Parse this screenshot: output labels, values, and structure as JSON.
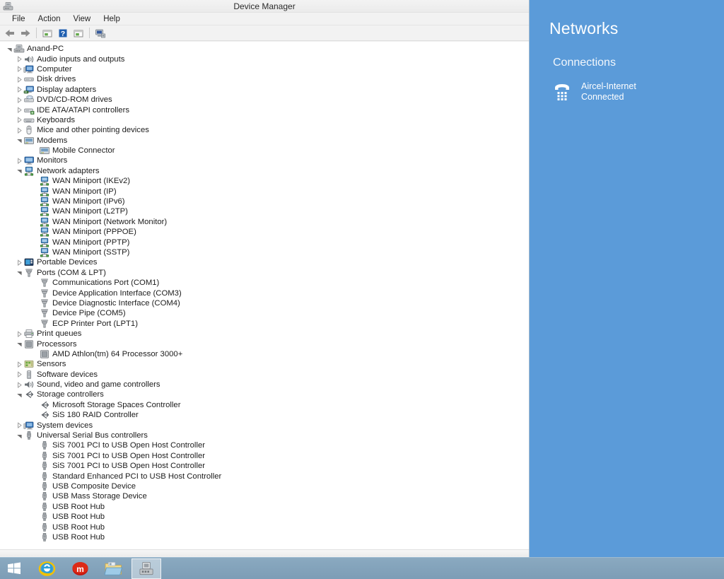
{
  "window": {
    "title": "Device Manager",
    "title_icon": "device-manager-icon",
    "menus": [
      "File",
      "Action",
      "View",
      "Help"
    ],
    "toolbar_buttons": [
      {
        "name": "back-button",
        "icon": "back-arrow-icon"
      },
      {
        "name": "forward-button",
        "icon": "forward-arrow-icon"
      },
      {
        "name": "show-hidden-devices-button",
        "icon": "window-list-icon"
      },
      {
        "name": "help-button",
        "icon": "question-mark-icon"
      },
      {
        "name": "properties-button",
        "icon": "window-list-icon"
      },
      {
        "name": "scan-hardware-changes-button",
        "icon": "scan-monitor-icon"
      }
    ]
  },
  "tree": [
    {
      "label": "Anand-PC",
      "level": 0,
      "state": "expanded",
      "icon": "computer-icon"
    },
    {
      "label": "Audio inputs and outputs",
      "level": 1,
      "state": "collapsed",
      "icon": "speaker-icon"
    },
    {
      "label": "Computer",
      "level": 1,
      "state": "collapsed",
      "icon": "computer-monitor-icon"
    },
    {
      "label": "Disk drives",
      "level": 1,
      "state": "collapsed",
      "icon": "disk-drive-icon"
    },
    {
      "label": "Display adapters",
      "level": 1,
      "state": "collapsed",
      "icon": "display-adapter-icon"
    },
    {
      "label": "DVD/CD-ROM drives",
      "level": 1,
      "state": "collapsed",
      "icon": "dvd-drive-icon"
    },
    {
      "label": "IDE ATA/ATAPI controllers",
      "level": 1,
      "state": "collapsed",
      "icon": "ide-controller-icon"
    },
    {
      "label": "Keyboards",
      "level": 1,
      "state": "collapsed",
      "icon": "keyboard-icon"
    },
    {
      "label": "Mice and other pointing devices",
      "level": 1,
      "state": "collapsed",
      "icon": "mouse-icon"
    },
    {
      "label": "Modems",
      "level": 1,
      "state": "expanded",
      "icon": "modem-icon"
    },
    {
      "label": "Mobile Connector",
      "level": 2,
      "state": "leaf",
      "icon": "modem-icon"
    },
    {
      "label": "Monitors",
      "level": 1,
      "state": "collapsed",
      "icon": "monitor-icon"
    },
    {
      "label": "Network adapters",
      "level": 1,
      "state": "expanded",
      "icon": "network-adapter-icon"
    },
    {
      "label": "WAN Miniport (IKEv2)",
      "level": 2,
      "state": "leaf",
      "icon": "network-adapter-icon"
    },
    {
      "label": "WAN Miniport (IP)",
      "level": 2,
      "state": "leaf",
      "icon": "network-adapter-icon"
    },
    {
      "label": "WAN Miniport (IPv6)",
      "level": 2,
      "state": "leaf",
      "icon": "network-adapter-icon"
    },
    {
      "label": "WAN Miniport (L2TP)",
      "level": 2,
      "state": "leaf",
      "icon": "network-adapter-icon"
    },
    {
      "label": "WAN Miniport (Network Monitor)",
      "level": 2,
      "state": "leaf",
      "icon": "network-adapter-icon"
    },
    {
      "label": "WAN Miniport (PPPOE)",
      "level": 2,
      "state": "leaf",
      "icon": "network-adapter-icon"
    },
    {
      "label": "WAN Miniport (PPTP)",
      "level": 2,
      "state": "leaf",
      "icon": "network-adapter-icon"
    },
    {
      "label": "WAN Miniport (SSTP)",
      "level": 2,
      "state": "leaf",
      "icon": "network-adapter-icon"
    },
    {
      "label": "Portable Devices",
      "level": 1,
      "state": "collapsed",
      "icon": "portable-device-icon"
    },
    {
      "label": "Ports (COM & LPT)",
      "level": 1,
      "state": "expanded",
      "icon": "port-icon"
    },
    {
      "label": "Communications Port (COM1)",
      "level": 2,
      "state": "leaf",
      "icon": "port-icon"
    },
    {
      "label": "Device Application Interface (COM3)",
      "level": 2,
      "state": "leaf",
      "icon": "port-icon"
    },
    {
      "label": "Device Diagnostic Interface (COM4)",
      "level": 2,
      "state": "leaf",
      "icon": "port-icon"
    },
    {
      "label": "Device Pipe (COM5)",
      "level": 2,
      "state": "leaf",
      "icon": "port-icon"
    },
    {
      "label": "ECP Printer Port (LPT1)",
      "level": 2,
      "state": "leaf",
      "icon": "port-icon"
    },
    {
      "label": "Print queues",
      "level": 1,
      "state": "collapsed",
      "icon": "printer-icon"
    },
    {
      "label": "Processors",
      "level": 1,
      "state": "expanded",
      "icon": "processor-icon"
    },
    {
      "label": "AMD Athlon(tm) 64 Processor 3000+",
      "level": 2,
      "state": "leaf",
      "icon": "processor-icon"
    },
    {
      "label": "Sensors",
      "level": 1,
      "state": "collapsed",
      "icon": "sensor-icon"
    },
    {
      "label": "Software devices",
      "level": 1,
      "state": "collapsed",
      "icon": "software-device-icon"
    },
    {
      "label": "Sound, video and game controllers",
      "level": 1,
      "state": "collapsed",
      "icon": "speaker-icon"
    },
    {
      "label": "Storage controllers",
      "level": 1,
      "state": "expanded",
      "icon": "storage-controller-icon"
    },
    {
      "label": "Microsoft Storage Spaces Controller",
      "level": 2,
      "state": "leaf",
      "icon": "storage-controller-icon"
    },
    {
      "label": "SiS 180 RAID Controller",
      "level": 2,
      "state": "leaf",
      "icon": "storage-controller-icon"
    },
    {
      "label": "System devices",
      "level": 1,
      "state": "collapsed",
      "icon": "computer-monitor-icon"
    },
    {
      "label": "Universal Serial Bus controllers",
      "level": 1,
      "state": "expanded",
      "icon": "usb-icon"
    },
    {
      "label": "SiS 7001 PCI to USB Open Host Controller",
      "level": 2,
      "state": "leaf",
      "icon": "usb-icon"
    },
    {
      "label": "SiS 7001 PCI to USB Open Host Controller",
      "level": 2,
      "state": "leaf",
      "icon": "usb-icon"
    },
    {
      "label": "SiS 7001 PCI to USB Open Host Controller",
      "level": 2,
      "state": "leaf",
      "icon": "usb-icon"
    },
    {
      "label": "Standard Enhanced PCI to USB Host Controller",
      "level": 2,
      "state": "leaf",
      "icon": "usb-icon"
    },
    {
      "label": "USB Composite Device",
      "level": 2,
      "state": "leaf",
      "icon": "usb-icon"
    },
    {
      "label": "USB Mass Storage Device",
      "level": 2,
      "state": "leaf",
      "icon": "usb-icon"
    },
    {
      "label": "USB Root Hub",
      "level": 2,
      "state": "leaf",
      "icon": "usb-icon"
    },
    {
      "label": "USB Root Hub",
      "level": 2,
      "state": "leaf",
      "icon": "usb-icon"
    },
    {
      "label": "USB Root Hub",
      "level": 2,
      "state": "leaf",
      "icon": "usb-icon"
    },
    {
      "label": "USB Root Hub",
      "level": 2,
      "state": "leaf",
      "icon": "usb-icon"
    }
  ],
  "networks": {
    "title": "Networks",
    "connections_heading": "Connections",
    "connections": [
      {
        "name": "Aircel-Internet",
        "status": "Connected",
        "icon": "dialup-phone-icon"
      }
    ],
    "background_color": "#5b9bd9"
  },
  "taskbar": {
    "background_color": "#809fb7",
    "start": {
      "name": "start-button",
      "icon": "windows-logo-icon"
    },
    "items": [
      {
        "name": "taskbar-internet-explorer",
        "icon": "internet-explorer-icon",
        "active": false
      },
      {
        "name": "taskbar-maxthon",
        "icon": "maxthon-browser-icon",
        "active": false
      },
      {
        "name": "taskbar-file-explorer",
        "icon": "file-explorer-icon",
        "active": false
      },
      {
        "name": "taskbar-device-manager",
        "icon": "device-manager-icon",
        "active": true
      }
    ]
  }
}
